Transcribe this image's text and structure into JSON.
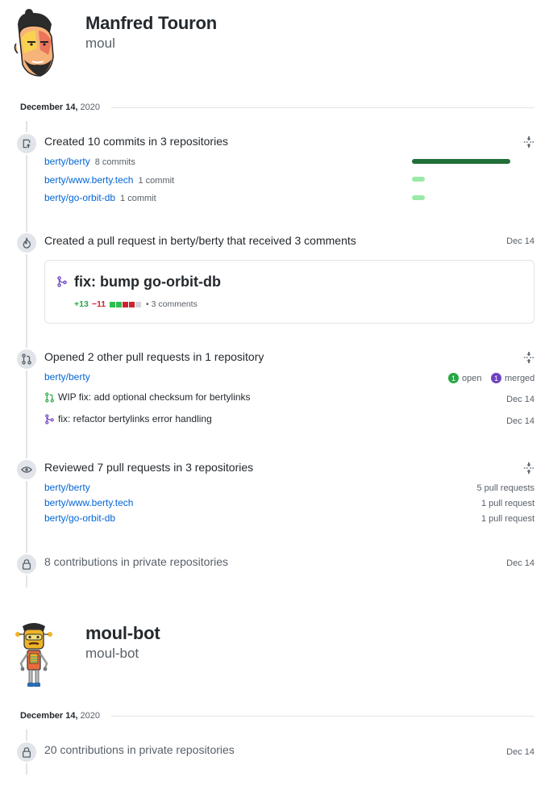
{
  "user1": {
    "name": "Manfred Touron",
    "login": "moul",
    "date_bold": "December 14,",
    "date_year": "2020",
    "commits": {
      "title": "Created 10 commits in 3 repositories",
      "repos": [
        {
          "name": "berty/berty",
          "count": "8 commits",
          "share": 1.0
        },
        {
          "name": "berty/www.berty.tech",
          "count": "1 commit",
          "share": 0.125
        },
        {
          "name": "berty/go-orbit-db",
          "count": "1 commit",
          "share": 0.125
        }
      ]
    },
    "created_pr": {
      "title": "Created a pull request in berty/berty that received 3 comments",
      "date": "Dec 14",
      "pr_title": "fix: bump go-orbit-db",
      "additions": "+13",
      "deletions": "−11",
      "comments": "• 3 comments"
    },
    "opened_prs": {
      "title": "Opened 2 other pull requests in 1 repository",
      "repo": "berty/berty",
      "open_count": "1",
      "open_label": "open",
      "merged_count": "1",
      "merged_label": "merged",
      "items": [
        {
          "title": "WIP fix: add optional checksum for bertylinks",
          "date": "Dec 14",
          "state": "open"
        },
        {
          "title": "fix: refactor bertylinks error handling",
          "date": "Dec 14",
          "state": "merged"
        }
      ]
    },
    "reviewed": {
      "title": "Reviewed 7 pull requests in 3 repositories",
      "repos": [
        {
          "name": "berty/berty",
          "count": "5 pull requests"
        },
        {
          "name": "berty/www.berty.tech",
          "count": "1 pull request"
        },
        {
          "name": "berty/go-orbit-db",
          "count": "1 pull request"
        }
      ]
    },
    "private": {
      "title": "8 contributions in private repositories",
      "date": "Dec 14"
    }
  },
  "user2": {
    "name": "moul-bot",
    "login": "moul-bot",
    "date_bold": "December 14,",
    "date_year": "2020",
    "private": {
      "title": "20 contributions in private repositories",
      "date": "Dec 14"
    }
  },
  "colors": {
    "link": "#0366d6",
    "green_bar": "#216e39",
    "light_bar": "#9be9a8",
    "open": "#28a745",
    "merged": "#6f42c1"
  }
}
